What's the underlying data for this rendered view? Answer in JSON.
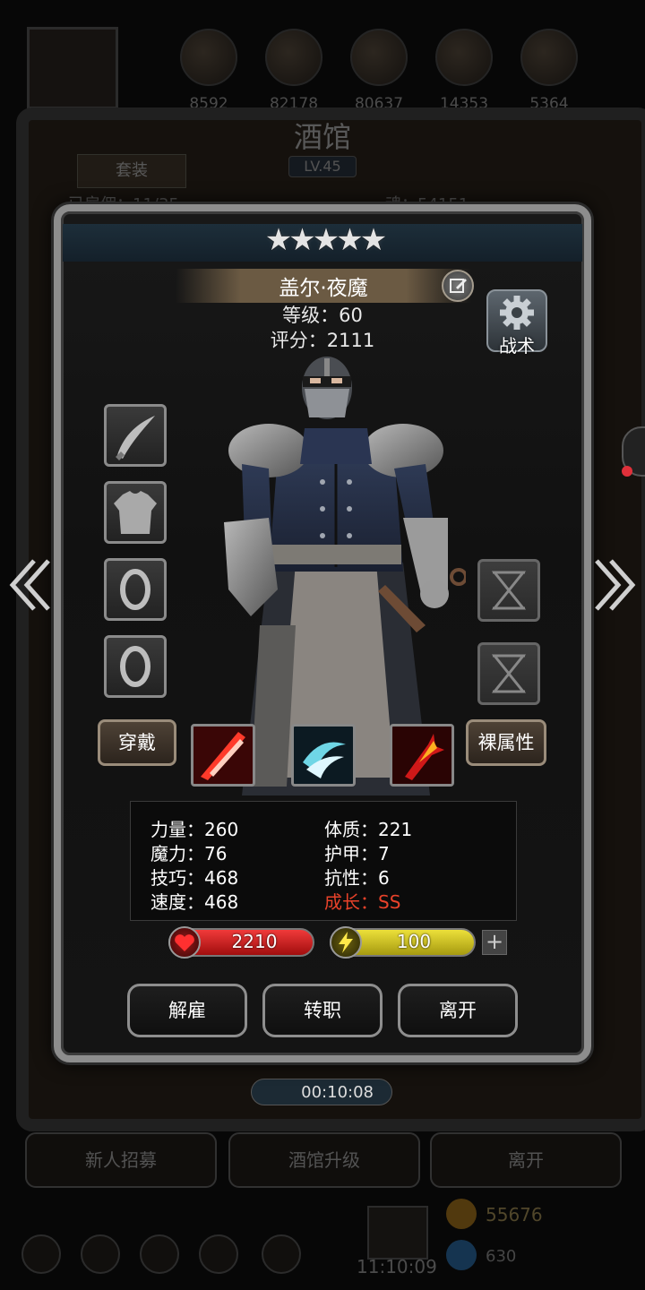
{
  "background": {
    "resources": [
      "8592",
      "82178",
      "80637",
      "14353",
      "5364"
    ],
    "title": "酒馆",
    "level": "LV.45",
    "tab": "套装",
    "recruit_count": "已雇佣：11/35",
    "soul": "魂：54151",
    "timer": "00:10:08",
    "buttons": [
      "新人招募",
      "酒馆升级",
      "离开"
    ],
    "gold": "55676",
    "gems": "630",
    "clock": "11:10:09"
  },
  "hero": {
    "stars": "★★★★★",
    "name": "盖尔·夜魔",
    "level": "等级：60",
    "score": "评分：2111",
    "tactics": "战术",
    "wear_button": "穿戴",
    "bare_stats_button": "裸属性",
    "stats": {
      "strength": "力量：260",
      "constitution": "体质：221",
      "magic": "魔力：76",
      "armor": "护甲：7",
      "skill": "技巧：468",
      "resist": "抗性：6",
      "speed": "速度：468",
      "growth": "成长：SS"
    },
    "hp": "2210",
    "energy": "100",
    "plus": "+"
  },
  "actions": {
    "dismiss": "解雇",
    "job_change": "转职",
    "leave": "离开"
  },
  "colors": {
    "growth": "#e8422a",
    "hp": "#d42020",
    "energy": "#d6c620",
    "frame": "#8d8d8d"
  },
  "icons": {
    "equip_slots": [
      "dagger-icon",
      "armor-icon",
      "ring-icon",
      "ring-icon"
    ],
    "right_slots": [
      "hourglass-icon",
      "hourglass-icon"
    ],
    "skills": [
      "fire-slash-skill-icon",
      "ice-vortex-skill-icon",
      "blood-strike-skill-icon"
    ]
  }
}
